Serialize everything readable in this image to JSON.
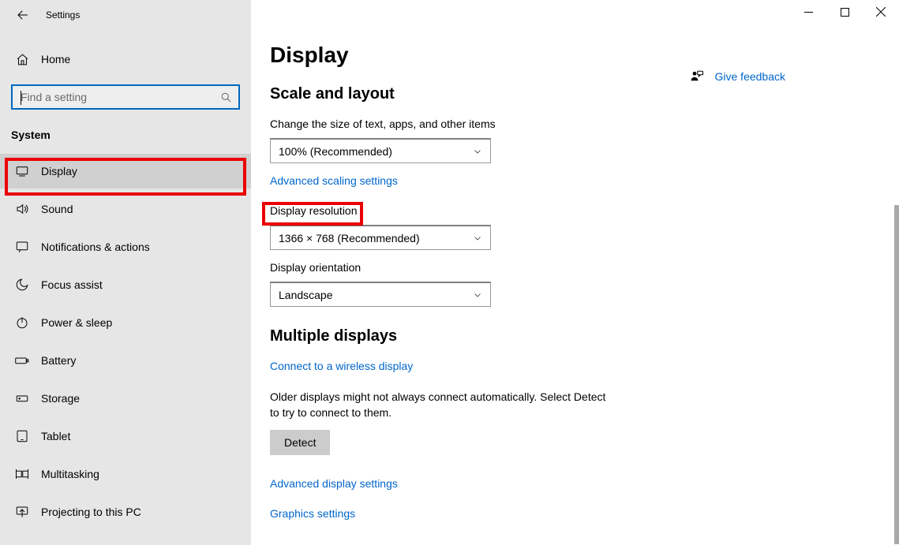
{
  "window": {
    "title": "Settings"
  },
  "sidebar": {
    "home_label": "Home",
    "search_placeholder": "Find a setting",
    "section_header": "System",
    "items": [
      {
        "label": "Display"
      },
      {
        "label": "Sound"
      },
      {
        "label": "Notifications & actions"
      },
      {
        "label": "Focus assist"
      },
      {
        "label": "Power & sleep"
      },
      {
        "label": "Battery"
      },
      {
        "label": "Storage"
      },
      {
        "label": "Tablet"
      },
      {
        "label": "Multitasking"
      },
      {
        "label": "Projecting to this PC"
      }
    ]
  },
  "main": {
    "title": "Display",
    "scale_section": "Scale and layout",
    "scale_label": "Change the size of text, apps, and other items",
    "scale_value": "100% (Recommended)",
    "advanced_scaling_link": "Advanced scaling settings",
    "resolution_heading": "Display resolution",
    "resolution_value": "1366 × 768 (Recommended)",
    "orientation_label": "Display orientation",
    "orientation_value": "Landscape",
    "multi_section": "Multiple displays",
    "wireless_link": "Connect to a wireless display",
    "detect_text": "Older displays might not always connect automatically. Select Detect to try to connect to them.",
    "detect_button": "Detect",
    "adv_display_link": "Advanced display settings",
    "graphics_link": "Graphics settings"
  },
  "feedback": {
    "label": "Give feedback"
  }
}
